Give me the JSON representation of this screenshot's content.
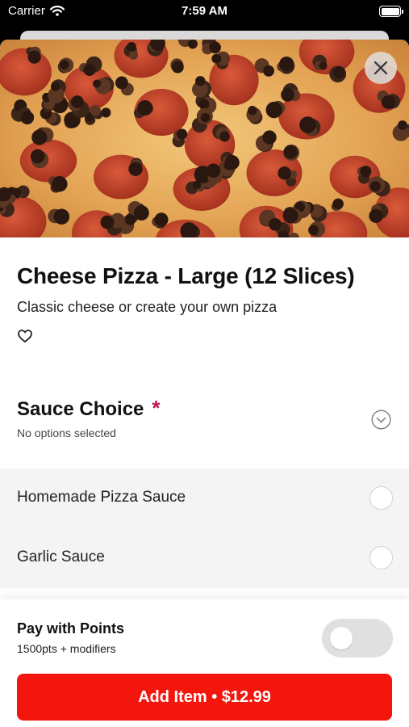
{
  "status_bar": {
    "carrier": "Carrier",
    "time": "7:59 AM",
    "wifi_icon": "wifi-icon",
    "battery_icon": "battery-icon"
  },
  "product": {
    "image_description": "pepperoni-sausage-pizza-photo",
    "title": "Cheese Pizza - Large (12 Slices)",
    "description": "Classic cheese or create your own pizza",
    "favorite_icon": "heart-icon",
    "close_icon": "close-icon"
  },
  "modifier_group": {
    "title": "Sauce Choice",
    "required_marker": "*",
    "status": "No options selected",
    "chevron_icon": "chevron-down-circle-icon",
    "options": [
      {
        "label": "Homemade Pizza Sauce",
        "selected": false
      },
      {
        "label": "Garlic Sauce",
        "selected": false
      }
    ]
  },
  "footer": {
    "pay_with_points_label": "Pay with Points",
    "points_detail": "1500pts + modifiers",
    "points_toggle_on": false,
    "add_button_label": "Add Item • $12.99"
  },
  "colors": {
    "accent_red": "#f4160c",
    "required_marker": "#c4164b",
    "options_background": "#f4f4f4"
  }
}
